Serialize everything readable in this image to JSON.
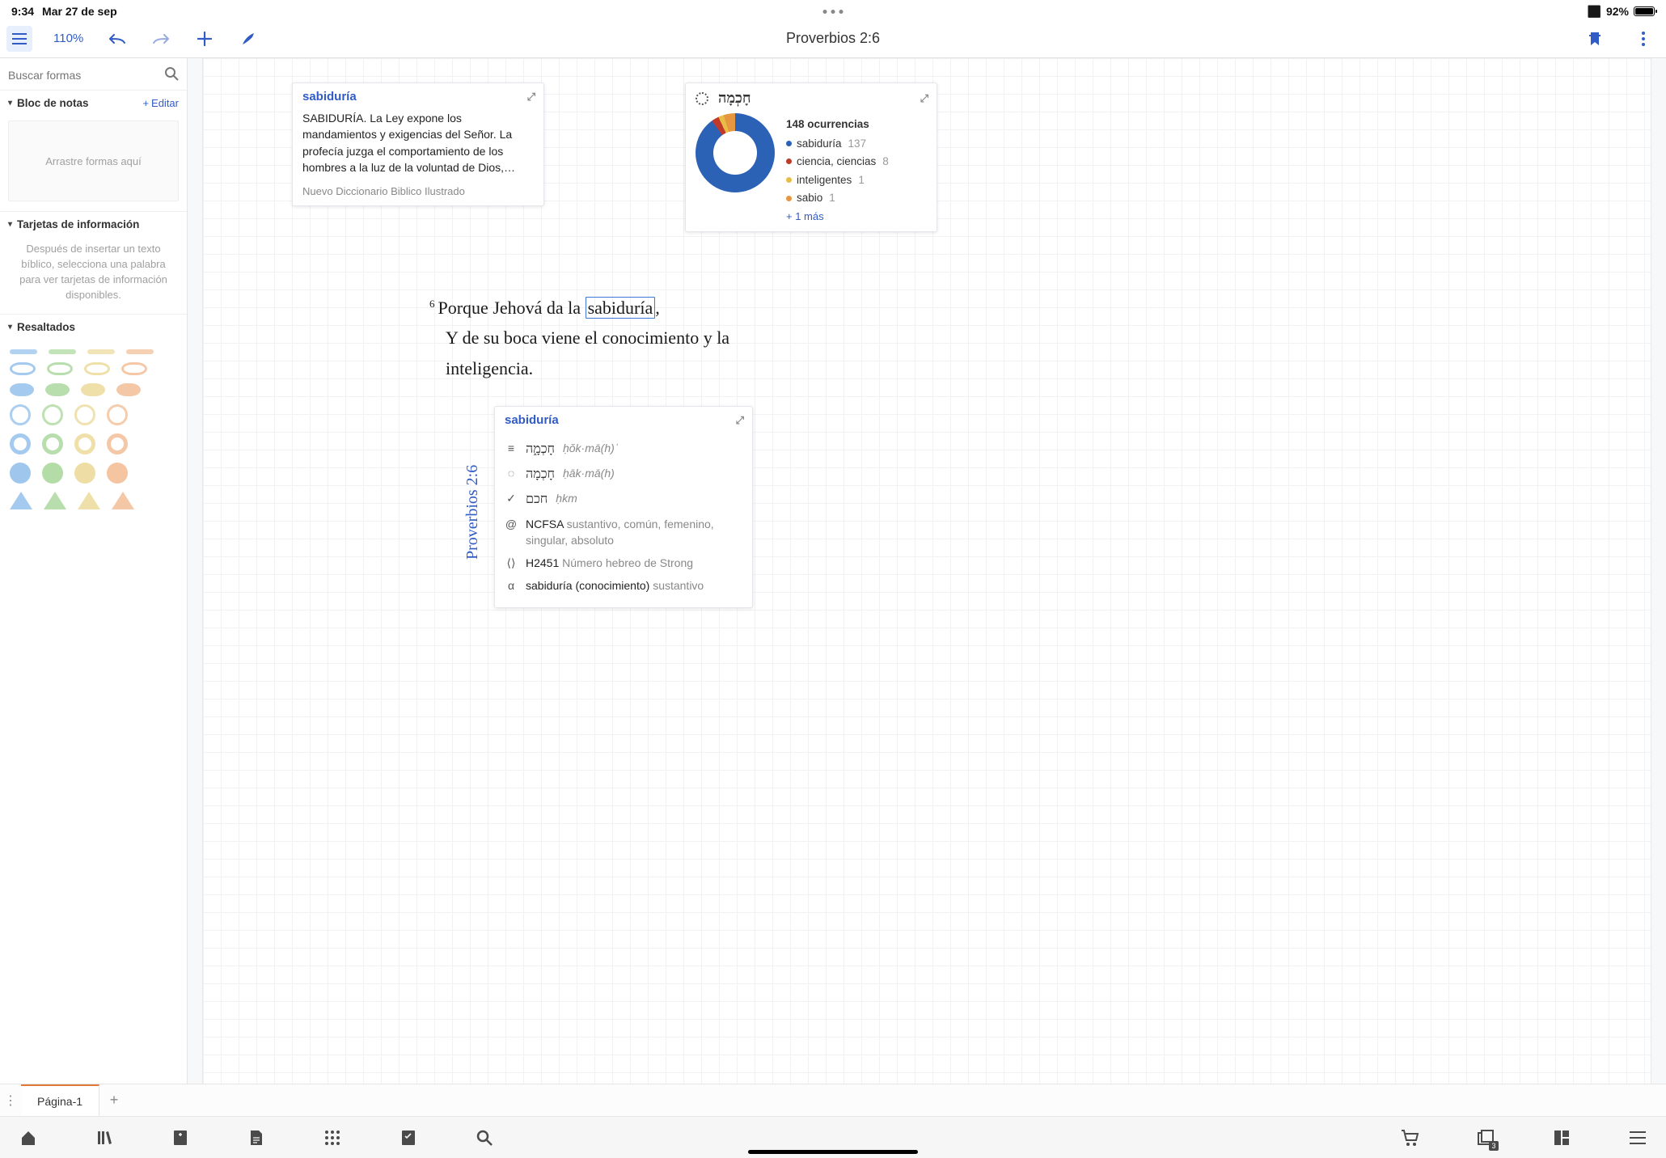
{
  "status_bar": {
    "time": "9:34",
    "date": "Mar 27 de sep",
    "battery_pct": "92%"
  },
  "toolbar": {
    "zoom": "110%",
    "title": "Proverbios 2:6"
  },
  "sidebar": {
    "search_placeholder": "Buscar formas",
    "sections": {
      "notepad": {
        "label": "Bloc de notas",
        "edit": "Editar",
        "dropzone": "Arrastre formas aquí"
      },
      "infocards": {
        "label": "Tarjetas de información",
        "help": "Después de insertar un texto bíblico, selecciona una palabra para ver tarjetas de información disponibles."
      },
      "highlights": {
        "label": "Resaltados"
      }
    }
  },
  "card_dict": {
    "title": "sabiduría",
    "body": "SABIDURÍA. La Ley expone los mandamientos y exigencias del Señor. La profecía juzga el comportamiento de los hombres a la luz de la voluntad de Dios,…",
    "source": "Nuevo Diccionario Biblico Ilustrado"
  },
  "card_heb": {
    "title_hebrew": "חָכְמָה",
    "occurrences_label": "148 ocurrencias",
    "items": [
      {
        "word": "sabiduría",
        "count": "137",
        "color": "blue"
      },
      {
        "word": "ciencia, ciencias",
        "count": "8",
        "color": "red"
      },
      {
        "word": "inteligentes",
        "count": "1",
        "color": "yellow"
      },
      {
        "word": "sabio",
        "count": "1",
        "color": "orange"
      }
    ],
    "more": "+ 1 más"
  },
  "chart_data": {
    "type": "pie",
    "title": "148 ocurrencias",
    "categories": [
      "sabiduría",
      "ciencia, ciencias",
      "inteligentes",
      "sabio",
      "(más)"
    ],
    "values": [
      137,
      8,
      1,
      1,
      1
    ],
    "colors": [
      "#2b62b5",
      "#c0392b",
      "#e8bd45",
      "#e6973f",
      "#cccccc"
    ]
  },
  "verse": {
    "number": "6",
    "line1_a": "Porque Jehová da la ",
    "highlight": "sabiduría",
    "line1_b": ",",
    "line2": "Y de su boca viene el conocimiento y la inteligencia.",
    "reference": "Proverbios 2:6"
  },
  "card_word": {
    "title": "sabiduría",
    "rows": {
      "manuscript": {
        "heb": "חָכְמָ֑ה",
        "translit": "ḥŏk·mā(h)ʾ"
      },
      "lemma": {
        "heb": "חָכְמָה",
        "translit": "ḥāk·mā(h)"
      },
      "root": {
        "heb": "חכם",
        "translit": "ḥkm"
      },
      "morph": {
        "code": "NCFSA",
        "desc": "sustantivo, común, femenino, singular, absoluto"
      },
      "strong": {
        "num": "H2451",
        "desc": "Número hebreo de Strong"
      },
      "sense": {
        "gloss": "sabiduría (conocimiento)",
        "pos": "sustantivo"
      }
    }
  },
  "tabs": {
    "page1": "Página-1"
  },
  "nav_badge": "3"
}
